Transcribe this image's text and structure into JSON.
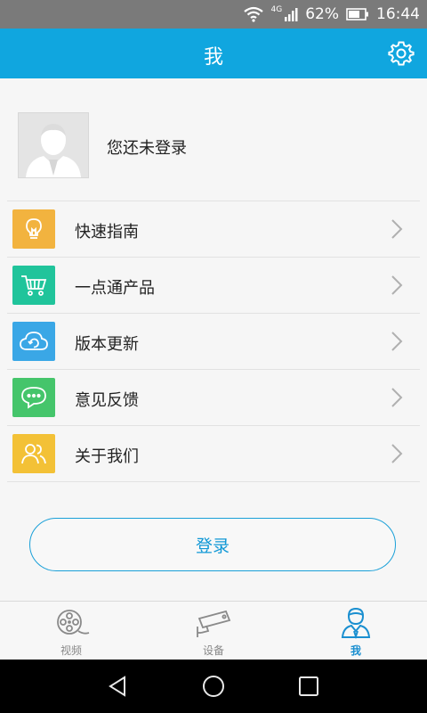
{
  "status_bar": {
    "network": "4G",
    "battery": "62%",
    "time": "16:44"
  },
  "header": {
    "title": "我"
  },
  "profile": {
    "status_text": "您还未登录"
  },
  "menu": {
    "items": [
      {
        "label": "快速指南",
        "icon": "lightbulb-icon",
        "color": "#f2b33f"
      },
      {
        "label": "一点通产品",
        "icon": "cart-icon",
        "color": "#20c49b"
      },
      {
        "label": "版本更新",
        "icon": "cloud-refresh-icon",
        "color": "#3aa7e6"
      },
      {
        "label": "意见反馈",
        "icon": "chat-bubble-icon",
        "color": "#45c56b"
      },
      {
        "label": "关于我们",
        "icon": "people-icon",
        "color": "#f3c136"
      }
    ]
  },
  "login_button": {
    "label": "登录"
  },
  "tabs": [
    {
      "label": "视频",
      "icon": "film-reel-icon",
      "active": false
    },
    {
      "label": "设备",
      "icon": "security-camera-icon",
      "active": false
    },
    {
      "label": "我",
      "icon": "user-icon",
      "active": true
    }
  ],
  "colors": {
    "accent": "#10a6df",
    "active_tab": "#1a8fd0"
  }
}
